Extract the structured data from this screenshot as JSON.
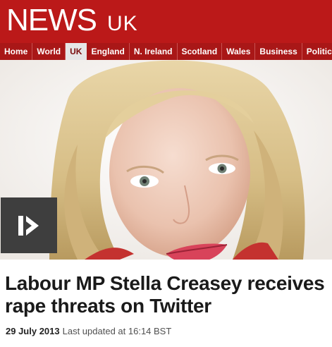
{
  "masthead": {
    "brand": "NEWS",
    "region": "UK",
    "background": "#bb1919"
  },
  "nav": {
    "items": [
      "Home",
      "World",
      "UK",
      "England",
      "N. Ireland",
      "Scotland",
      "Wales",
      "Business",
      "Politics"
    ],
    "active": "UK"
  },
  "hero": {
    "image": "portrait-photo",
    "play_icon": "video-play-icon"
  },
  "article": {
    "headline": "Labour MP Stella Creasey receives rape threats on Twitter",
    "date": "29 July 2013",
    "updated": "Last updated at 16:14 BST"
  }
}
